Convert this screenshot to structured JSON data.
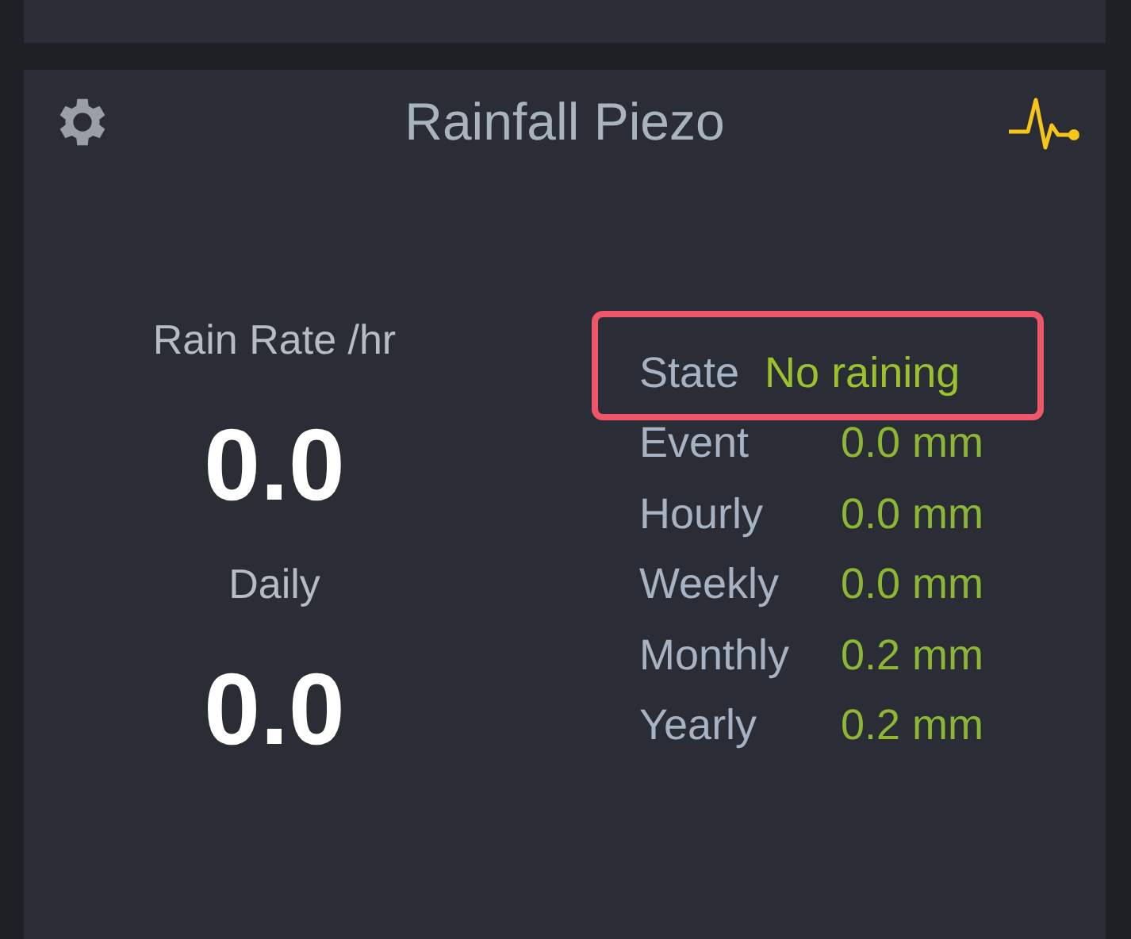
{
  "widget": {
    "title": "Rainfall Piezo",
    "left": [
      {
        "label": "Rain Rate /hr",
        "value": "0.0"
      },
      {
        "label": "Daily",
        "value": "0.0"
      }
    ],
    "rows": [
      {
        "kind": "state",
        "label": "State",
        "value": "No raining",
        "highlighted": true
      },
      {
        "kind": "total",
        "label": "Event",
        "value": "0.0 mm",
        "highlighted": false
      },
      {
        "kind": "total",
        "label": "Hourly",
        "value": "0.0 mm",
        "highlighted": false
      },
      {
        "kind": "total",
        "label": "Weekly",
        "value": "0.0 mm",
        "highlighted": false
      },
      {
        "kind": "total",
        "label": "Monthly",
        "value": "0.2 mm",
        "highlighted": false
      },
      {
        "kind": "total",
        "label": "Yearly",
        "value": "0.2 mm",
        "highlighted": false
      }
    ]
  }
}
